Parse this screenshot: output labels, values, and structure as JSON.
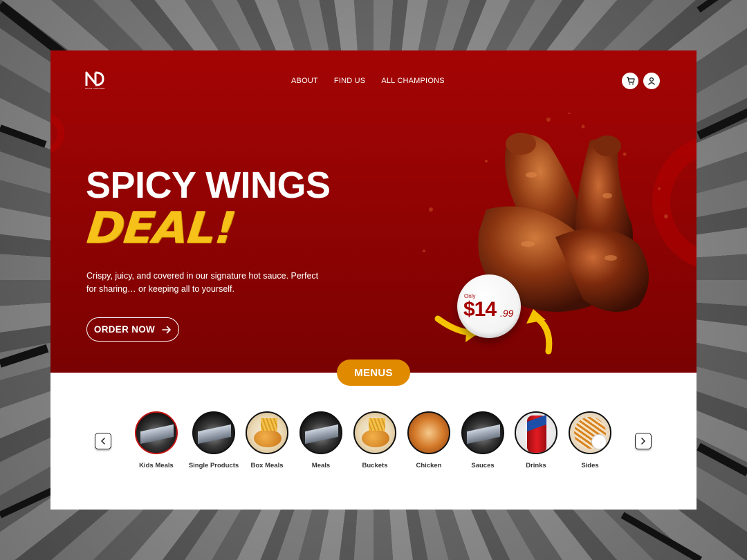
{
  "nav": {
    "items": [
      "ABOUT",
      "FIND US",
      "ALL CHAMPIONS"
    ]
  },
  "logo": {
    "mark": "ND",
    "tagline": "NIKOS DESIGNER"
  },
  "hero": {
    "title_line1": "SPICY WINGS",
    "title_line2": "DEAL!",
    "description": "Crispy, juicy, and covered in our signature hot sauce. Perfect for sharing… or keeping all to yourself.",
    "cta_label": "ORDER NOW",
    "price_prefix": "Only",
    "price_main": "$14",
    "price_cents": ".99"
  },
  "menus": {
    "heading": "MENUS",
    "prev_icon": "chevron-left-icon",
    "next_icon": "chevron-right-icon",
    "categories": [
      {
        "label": "Kids Meals",
        "active": true
      },
      {
        "label": "Single Products",
        "active": false
      },
      {
        "label": "Box Meals",
        "active": false
      },
      {
        "label": "Meals",
        "active": false
      },
      {
        "label": "Buckets",
        "active": false
      },
      {
        "label": "Chicken",
        "active": false
      },
      {
        "label": "Sauces",
        "active": false
      },
      {
        "label": "Drinks",
        "active": false
      },
      {
        "label": "Sides",
        "active": false
      }
    ]
  },
  "colors": {
    "brand_red": "#a40404",
    "accent_yellow": "#f6c21a",
    "menus_orange": "#e08a00"
  }
}
